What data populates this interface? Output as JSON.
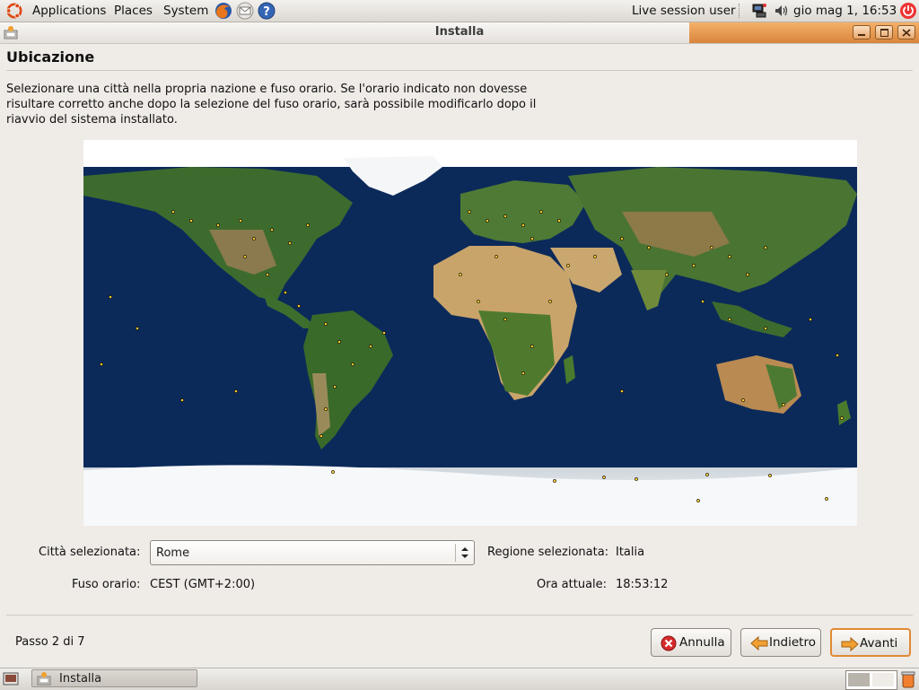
{
  "top_panel": {
    "menus": [
      "Applications",
      "Places",
      "System"
    ],
    "user": "Live session user",
    "clock": "gio mag  1, 16:53"
  },
  "window": {
    "title": "Installa"
  },
  "page": {
    "heading": "Ubicazione",
    "intro": "Selezionare una città nella propria nazione e fuso orario. Se l'orario indicato non dovesse risultare corretto anche dopo la selezione del fuso orario, sarà possibile modificarlo dopo il riavvio del sistema installato."
  },
  "form": {
    "city_label": "Città selezionata:",
    "city_value": "Rome",
    "region_label": "Regione selezionata:",
    "region_value": "Italia",
    "tz_label": "Fuso orario:",
    "tz_value": "CEST (GMT+2:00)",
    "time_label": "Ora attuale:",
    "time_value": "18:53:12"
  },
  "footer": {
    "step": "Passo 2 di 7",
    "cancel": "Annulla",
    "back": "Indietro",
    "next": "Avanti"
  },
  "taskbar": {
    "task_label": "Installa"
  },
  "colors": {
    "accent": "#e08a35",
    "ocean": "#0b2a5a",
    "panel": "#efebe7"
  }
}
